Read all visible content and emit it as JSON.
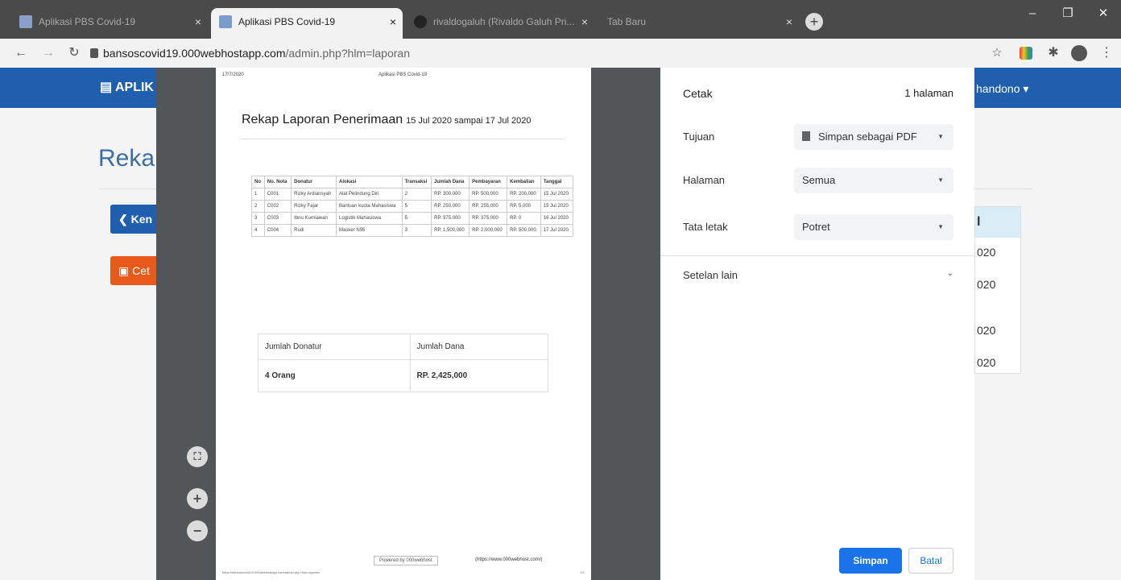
{
  "browser": {
    "tabs": [
      {
        "label": "Aplikasi PBS Covid-19",
        "active": false
      },
      {
        "label": "Aplikasi PBS Covid-19",
        "active": true
      },
      {
        "label": "rivaldogaluh (Rivaldo Galuh Pri...",
        "active": false
      },
      {
        "label": "Tab Baru",
        "active": false
      }
    ],
    "tab_close": "×",
    "new_tab": "+",
    "url_host": "bansoscovid19.000webhostapp.com",
    "url_path": "/admin.php?hlm=laporan",
    "win_min": "–",
    "win_max": "❐",
    "win_close": "✕"
  },
  "app": {
    "brand": "APLIK",
    "user": "handono ▾",
    "title": "Reka",
    "back_label": "Ken",
    "print_label": "Cet",
    "table_header": "l",
    "table_cells": [
      "020",
      "020",
      "020",
      "020"
    ]
  },
  "preview": {
    "zoom_fit": "⛶",
    "zoom_in": "+",
    "zoom_out": "−"
  },
  "document": {
    "header_date": "17/7/2020",
    "header_title": "Aplikasi PBS Covid-19",
    "heading": "Rekap Laporan Penerimaan",
    "heading_sub": "15 Jul 2020 sampai 17 Jul 2020",
    "columns": [
      "No",
      "No. Nota",
      "Donatur",
      "Alokasi",
      "Transaksi",
      "Jumlah Dana",
      "Pembayaran",
      "Kembalian",
      "Tanggal"
    ],
    "rows": [
      [
        "1",
        "C001",
        "Rizky Ardiansyah",
        "Alat Pelindung Diri",
        "2",
        "RP. 300.000",
        "RP. 500,000",
        "RP. 200,000",
        "15 Jul 2020"
      ],
      [
        "2",
        "C002",
        "Rizky Fajar",
        "Bantuan kuota Mahasiswa",
        "5",
        "RP. 250,000",
        "RP. 255,000",
        "RP. 5,000",
        "15 Jul 2020"
      ],
      [
        "3",
        "C003",
        "Ibnu Kurniawan",
        "Logistik Mahasiswa",
        "5",
        "RP. 375.000",
        "RP. 375,000",
        "RP. 0",
        "16 Jul 2020"
      ],
      [
        "4",
        "C004",
        "Rudi",
        "Masker N95",
        "3",
        "RP. 1,500,000",
        "RP. 2,000,000",
        "RP. 500,000",
        "17 Jul 2020"
      ]
    ],
    "summary": {
      "label_donatur": "Jumlah Donatur",
      "label_dana": "Jumlah Dana",
      "value_donatur": "4 Orang",
      "value_dana": "RP. 2,425,000"
    },
    "powered": "Powered by 000webhost",
    "powered_link": "(https://www.000webhost.com/)",
    "footer_url": "https://bansoscovid19.000webhostapp.com/admin.php?hlm=laporan",
    "footer_page": "1/1"
  },
  "print_panel": {
    "title": "Cetak",
    "page_count": "1 halaman",
    "dest_label": "Tujuan",
    "dest_value": "Simpan sebagai PDF",
    "pages_label": "Halaman",
    "pages_value": "Semua",
    "layout_label": "Tata letak",
    "layout_value": "Potret",
    "more_label": "Setelan lain",
    "save_label": "Simpan",
    "cancel_label": "Batal"
  }
}
